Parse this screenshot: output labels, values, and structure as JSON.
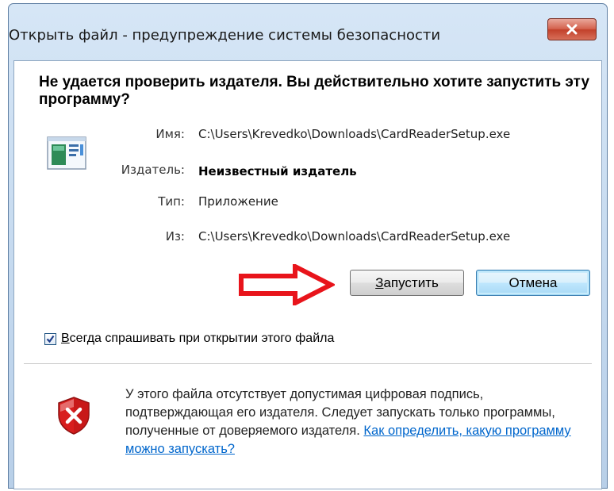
{
  "window": {
    "title": "Открыть файл - предупреждение системы безопасности",
    "close_icon": "close-icon"
  },
  "dialog": {
    "heading": "Не удается проверить издателя.  Вы действительно хотите запустить эту программу?",
    "file_icon": "application-file-icon",
    "fields": {
      "name_label": "Имя:",
      "name_value": "C:\\Users\\Krevedko\\Downloads\\CardReaderSetup.exe",
      "publisher_label": "Издатель:",
      "publisher_value": "Неизвестный издатель",
      "type_label": "Тип:",
      "type_value": "Приложение",
      "from_label": "Из:",
      "from_value": "C:\\Users\\Krevedko\\Downloads\\CardReaderSetup.exe"
    },
    "buttons": {
      "run_label": "Запустить",
      "cancel_label": "Отмена"
    },
    "annotation": {
      "icon": "red-arrow-icon",
      "color": "#e8141b"
    },
    "checkbox": {
      "label": "Всегда спрашивать при открытии этого файла",
      "checked": true
    },
    "warning": {
      "icon": "shield-error-icon",
      "text": "У этого файла отсутствует допустимая цифровая подпись, подтверждающая его издателя.  Следует запускать только программы, полученные от доверяемого издателя.",
      "link_text": "Как определить, какую программу можно запускать?"
    }
  },
  "colors": {
    "titlebar": "#c3d8ee",
    "close_button": "#c2402a",
    "link": "#0066cc",
    "default_button_border": "#3c7fb1"
  }
}
